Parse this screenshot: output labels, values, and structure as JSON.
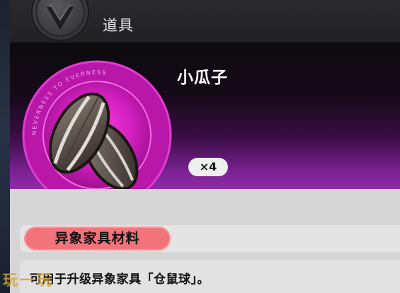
{
  "header": {
    "title": "道具",
    "logo_icon": "v-emblem-icon"
  },
  "item": {
    "name": "小瓜子",
    "count": "×4",
    "icon": "sunflower-seeds-icon",
    "medallion_ring_text": "NEVERNESS TO EVERNESS",
    "category": "异象家具材料",
    "description": "可用于升级异象家具「仓鼠球」。"
  },
  "watermark": {
    "text": "玩一玩"
  },
  "colors": {
    "medallion": "#c81fb8",
    "category_tag": "#f2737a",
    "hero_gradient_end": "#8f2aa8",
    "watermark": "#d4a42c"
  }
}
